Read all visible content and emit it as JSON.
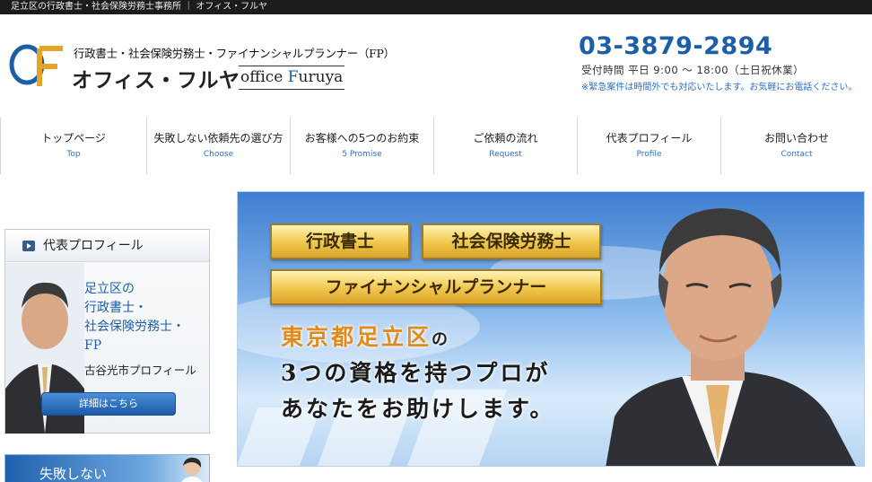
{
  "topbar": {
    "text": "足立区の行政書士・社会保険労務士事務所 ｜ オフィス・フルヤ"
  },
  "header": {
    "logo_mark": "OF",
    "subtitle": "行政書士・社会保険労務士・ファイナンシャルプランナー（FP）",
    "name": "オフィス・フルヤ",
    "english_prefix": "office ",
    "english_cap": "F",
    "english_rest": "uruya",
    "phone": "03-3879-2894",
    "hours": "受付時間 平日 9:00 ～ 18:00（土日祝休業）",
    "note": "※緊急案件は時間外でも対応いたします。お気軽にお電話ください。",
    "accent_color": "#1d5fa6"
  },
  "nav": {
    "items": [
      {
        "label": "トップページ",
        "sub": "Top"
      },
      {
        "label": "失敗しない依頼先の選び方",
        "sub": "Choose"
      },
      {
        "label": "お客様への5つのお約束",
        "sub": "5 Promise"
      },
      {
        "label": "ご依頼の流れ",
        "sub": "Request"
      },
      {
        "label": "代表プロフィール",
        "sub": "Profile"
      },
      {
        "label": "お問い合わせ",
        "sub": "Contact"
      }
    ]
  },
  "sidebar": {
    "profile_title": "代表プロフィール",
    "profile_lines": [
      "足立区の",
      "行政書士・",
      "社会保険労務士・",
      "FP"
    ],
    "profile_name": "古谷光市プロフィール",
    "detail_button": "詳細はこちら",
    "fail_banner": "失敗しない"
  },
  "hero": {
    "tag1": "行政書士",
    "tag2": "社会保険労務士",
    "tag3": "ファイナンシャルプランナー",
    "line1_main": "東京都足立区",
    "line1_suffix": "の",
    "line2": "3つの資格を持つプロが",
    "line3": "あなたをお助けします。"
  }
}
